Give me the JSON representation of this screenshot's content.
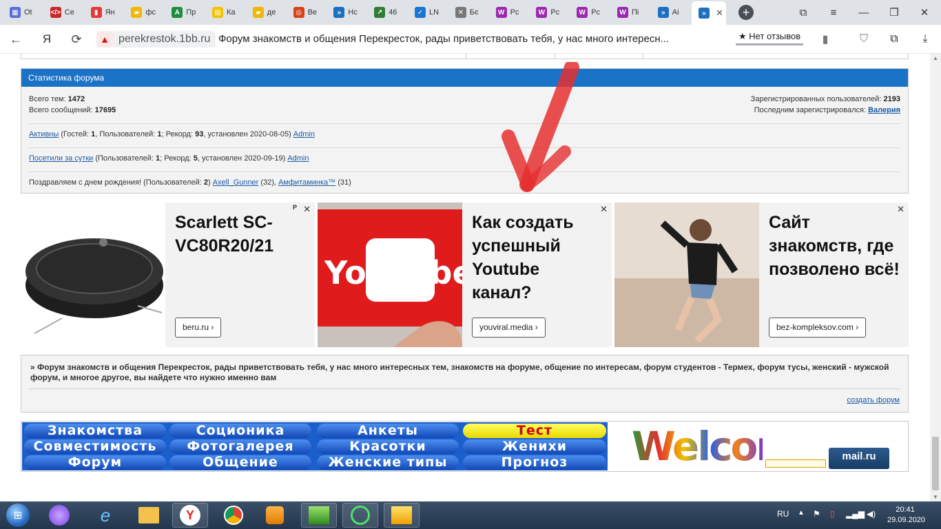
{
  "browser": {
    "tabs": [
      {
        "label": "Ot",
        "icon": "calendar-icon",
        "color": "#5a6fd6"
      },
      {
        "label": "Ce",
        "icon": "code-icon",
        "color": "#c62828"
      },
      {
        "label": "Ян",
        "icon": "bar-chart-icon",
        "color": "#e53935"
      },
      {
        "label": "фс",
        "icon": "folder-icon",
        "color": "#f2b705"
      },
      {
        "label": "Пр",
        "icon": "letter-a-icon",
        "color": "#1e8e3e"
      },
      {
        "label": "Ка",
        "icon": "document-icon",
        "color": "#f2c200"
      },
      {
        "label": "де",
        "icon": "folder-icon",
        "color": "#f2b705"
      },
      {
        "label": "Be",
        "icon": "target-icon",
        "color": "#d84315"
      },
      {
        "label": "Нс",
        "icon": "forum-icon",
        "color": "#1e6fbf"
      },
      {
        "label": "46",
        "icon": "arrow-icon",
        "color": "#2e7d32"
      },
      {
        "label": "LN",
        "icon": "check-icon",
        "color": "#1976d2"
      },
      {
        "label": "Бє",
        "icon": "cross-icon",
        "color": "#777777"
      },
      {
        "label": "Рс",
        "icon": "letter-w-icon",
        "color": "#9c27b0"
      },
      {
        "label": "Рс",
        "icon": "letter-w-icon",
        "color": "#9c27b0"
      },
      {
        "label": "Рс",
        "icon": "letter-w-icon",
        "color": "#9c27b0"
      },
      {
        "label": "Пі",
        "icon": "letter-w-icon",
        "color": "#9c27b0"
      },
      {
        "label": "Ai",
        "icon": "forum-icon",
        "color": "#1e6fbf"
      }
    ],
    "domain": "perekrestok.1bb.ru",
    "page_title": "Форум знакомств и общения Перекресток, рады приветствовать тебя, у нас много интересн...",
    "reviews": "★ Нет отзывов"
  },
  "stats": {
    "header": "Статистика форума",
    "total_topics_label": "Всего тем:",
    "total_topics": "1472",
    "total_posts_label": "Всего сообщений:",
    "total_posts": "17695",
    "registered_label": "Зарегистрированных пользователей:",
    "registered": "2193",
    "last_registered_label": "Последним зарегистрировался:",
    "last_registered": "Валерия",
    "active_link": "Активны",
    "active_open": " (Гостей: ",
    "active_guests": "1",
    "active_users_label": ", Пользователей: ",
    "active_users": "1",
    "active_record_label": "; Рекорд: ",
    "active_record": "93",
    "active_record_date": ", установлен 2020-08-05)",
    "active_user_link": "Admin",
    "visited_link": "Посетили за сутки",
    "visited_open": " (Пользователей: ",
    "visited_users": "1",
    "visited_record_label": "; Рекорд: ",
    "visited_record": "5",
    "visited_record_date": ", установлен 2020-09-19)",
    "visited_user_link": "Admin",
    "birthday_text": "Поздравляем с днем рождения! (Пользователей: ",
    "birthday_count": "2",
    "birthday_close": ") ",
    "birthday_user1": "Axell_Gunner",
    "birthday_user1_age": " (32), ",
    "birthday_user2": "Амфитаминка™",
    "birthday_user2_age": " (31)"
  },
  "ads": [
    {
      "title": "Scarlett SC-VC80R20/21",
      "button": "beru.ru ›",
      "mark": "P",
      "image": "robot-vacuum-image"
    },
    {
      "title": "Как создать успешный Youtube канал?",
      "button": "youviral.media ›",
      "image": "youtube-phone-image",
      "logo_text": "YouTube"
    },
    {
      "title": "Сайт знакомств, где позволено всё!",
      "button": "bez-kompleksov.com ›",
      "image": "dancing-woman-image"
    }
  ],
  "description": {
    "text": "» Форум знакомств и общения Перекресток, рады приветствовать тебя, у нас много интересных тем, знакомств на форуме, общение по интересам, форум студентов - Термех, форум тусы, женский - мужской форум, и многое другое, вы найдете что нужно именно вам",
    "create_link": "создать форум"
  },
  "banner_nav": [
    "Знакомства",
    "Соционика",
    "Анкеты",
    "Тест",
    "Совместимость",
    "Фотогалерея",
    "Красотки",
    "Женихи",
    "Форум",
    "Общение",
    "Женские типы",
    "Прогноз"
  ],
  "welcome_banner": "Welcome",
  "mailru_logo": {
    "main": "mail",
    "dot": ".",
    "suffix": "ru"
  },
  "taskbar": {
    "lang": "RU",
    "time": "20:41",
    "date": "29.09.2020"
  }
}
